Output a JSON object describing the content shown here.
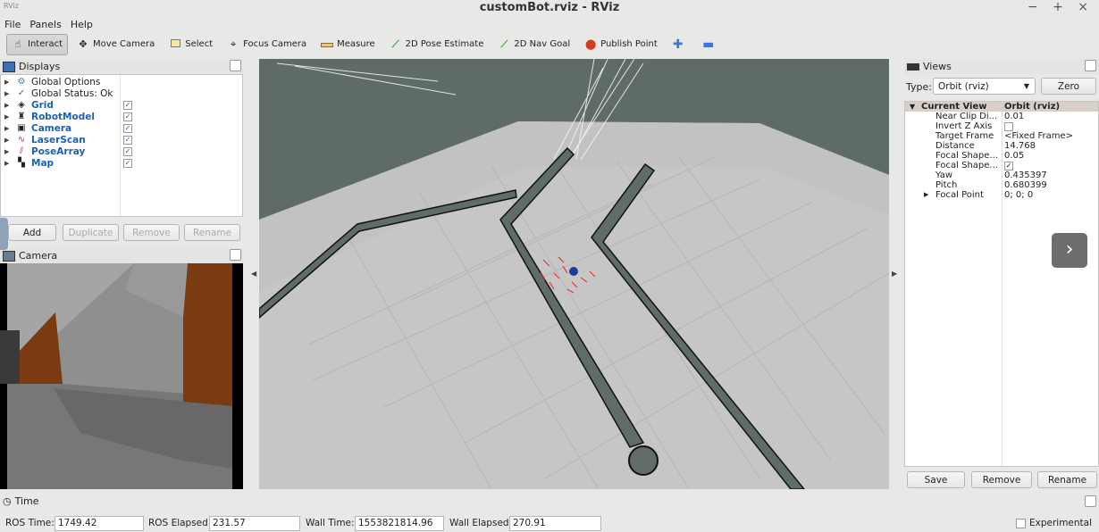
{
  "window": {
    "title": "customBot.rviz - RViz",
    "app_icon": "rviz-icon",
    "controls": [
      "−",
      "+",
      "×"
    ]
  },
  "menu": [
    "File",
    "Panels",
    "Help"
  ],
  "toolbar": {
    "interact": "Interact",
    "move_camera": "Move Camera",
    "select": "Select",
    "focus_camera": "Focus Camera",
    "measure": "Measure",
    "pose_estimate": "2D Pose Estimate",
    "nav_goal": "2D Nav Goal",
    "publish_point": "Publish Point"
  },
  "displays": {
    "title": "Displays",
    "items": [
      {
        "label": "Global Options",
        "icon": "gear-icon",
        "checked": null,
        "bold": false
      },
      {
        "label": "Global Status: Ok",
        "icon": "check-icon",
        "checked": null,
        "bold": false
      },
      {
        "label": "Grid",
        "icon": "grid-icon",
        "checked": true,
        "bold": true
      },
      {
        "label": "RobotModel",
        "icon": "robot-icon",
        "checked": true,
        "bold": true
      },
      {
        "label": "Camera",
        "icon": "camera-icon",
        "checked": true,
        "bold": true
      },
      {
        "label": "LaserScan",
        "icon": "laserscan-icon",
        "checked": true,
        "bold": true
      },
      {
        "label": "PoseArray",
        "icon": "posearray-icon",
        "checked": true,
        "bold": true
      },
      {
        "label": "Map",
        "icon": "map-icon",
        "checked": true,
        "bold": true
      }
    ],
    "buttons": {
      "add": "Add",
      "duplicate": "Duplicate",
      "remove": "Remove",
      "rename": "Rename"
    }
  },
  "camera_panel": {
    "title": "Camera"
  },
  "views": {
    "title": "Views",
    "type_label": "Type:",
    "type_value": "Orbit (rviz)",
    "zero": "Zero",
    "current_view": {
      "name": "Current View",
      "value": "Orbit (rviz)"
    },
    "properties": [
      {
        "name": "Near Clip Di...",
        "value": "0.01"
      },
      {
        "name": "Invert Z Axis",
        "value": ""
      },
      {
        "name": "Target Frame",
        "value": "<Fixed Frame>"
      },
      {
        "name": "Distance",
        "value": "14.768"
      },
      {
        "name": "Focal Shape...",
        "value": "0.05"
      },
      {
        "name": "Focal Shape...",
        "value": "✓"
      },
      {
        "name": "Yaw",
        "value": "0.435397"
      },
      {
        "name": "Pitch",
        "value": "0.680399"
      },
      {
        "name": "Focal Point",
        "value": "0; 0; 0"
      }
    ],
    "buttons": {
      "save": "Save",
      "remove": "Remove",
      "rename": "Rename"
    }
  },
  "time": {
    "title": "Time",
    "ros_time_label": "ROS Time:",
    "ros_time": "1749.42",
    "ros_elapsed_label": "ROS Elapsed:",
    "ros_elapsed": "231.57",
    "wall_time_label": "Wall Time:",
    "wall_time": "1553821814.96",
    "wall_elapsed_label": "Wall Elapsed:",
    "wall_elapsed": "270.91",
    "experimental": "Experimental"
  },
  "next_button": "›"
}
